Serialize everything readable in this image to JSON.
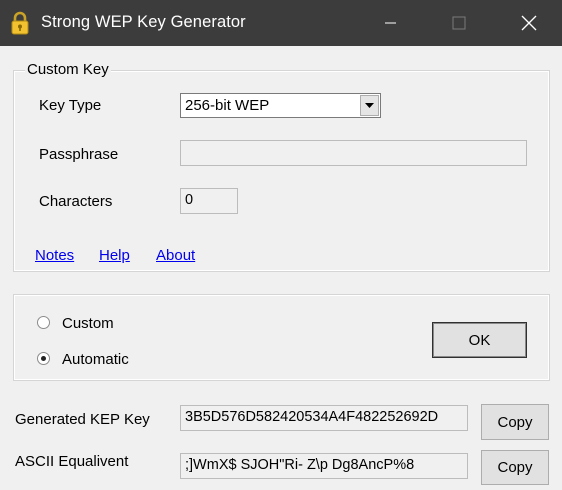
{
  "window": {
    "title": "Strong WEP Key Generator",
    "controls": [
      "minimize",
      "maximize",
      "close"
    ]
  },
  "custom_key": {
    "legend": "Custom Key",
    "key_type_label": "Key Type",
    "key_type_value": "256-bit WEP",
    "passphrase_label": "Passphrase",
    "passphrase_value": "",
    "characters_label": "Characters",
    "characters_value": "0"
  },
  "links": {
    "notes": "Notes",
    "help": "Help",
    "about": "About"
  },
  "mode": {
    "custom_label": "Custom",
    "automatic_label": "Automatic",
    "selected": "Automatic",
    "ok_label": "OK"
  },
  "output": {
    "generated_label": "Generated KEP Key",
    "generated_value": "3B5D576D582420534A4F482252692D",
    "ascii_label": "ASCII Equalivent",
    "ascii_value": ";]WmX$ SJOH\"Ri- Z\\p Dg8AncP%8",
    "copy_label": "Copy"
  },
  "colors": {
    "titlebar": "#3c3c3c",
    "link": "#0000ee",
    "background": "#f0f0f0"
  },
  "icons": {
    "app": "padlock-icon"
  }
}
